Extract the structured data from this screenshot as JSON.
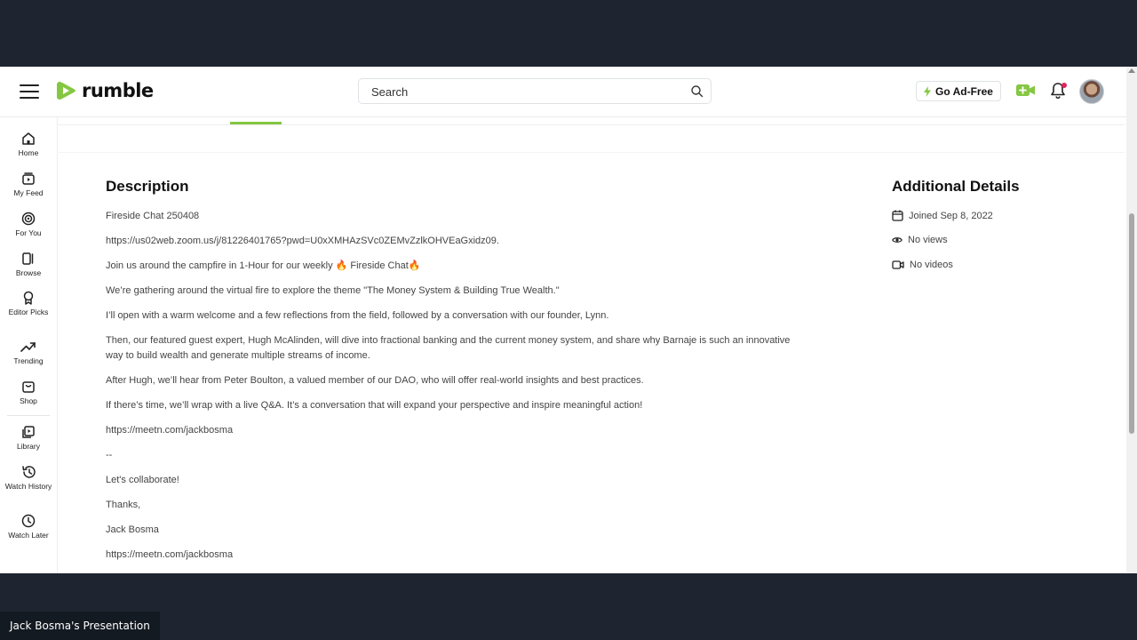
{
  "header": {
    "logo_text": "rumble",
    "search_placeholder": "Search",
    "ad_free_label": "Go Ad-Free",
    "brand_color": "#85c742"
  },
  "sidebar": {
    "items": [
      {
        "label": "Home",
        "icon": "home-icon"
      },
      {
        "label": "My Feed",
        "icon": "feed-icon"
      },
      {
        "label": "For You",
        "icon": "target-icon"
      },
      {
        "label": "Browse",
        "icon": "browse-icon"
      },
      {
        "label": "Editor Picks",
        "icon": "award-icon"
      },
      {
        "label": "Trending",
        "icon": "trending-icon"
      },
      {
        "label": "Shop",
        "icon": "shop-icon"
      },
      {
        "label": "Library",
        "icon": "library-icon"
      },
      {
        "label": "Watch History",
        "icon": "history-icon"
      },
      {
        "label": "Watch Later",
        "icon": "clock-icon"
      }
    ]
  },
  "description": {
    "title": "Description",
    "paragraphs": [
      "Fireside Chat 250408",
      "https://us02web.zoom.us/j/81226401765?pwd=U0xXMHAzSVc0ZEMvZzlkOHVEaGxidz09.",
      "Join us around the campfire in 1-Hour for our weekly 🔥 Fireside Chat🔥",
      "We’re gathering around the virtual fire to explore the theme \"The Money System & Building True Wealth.\"",
      "I’ll open with a warm welcome and a few reflections from the field, followed by a conversation with our founder, Lynn.",
      "Then, our featured guest expert, Hugh McAlinden, will dive into fractional banking and the current money system, and share why Barnaje is such an innovative way to build wealth and generate multiple streams of income.",
      "After Hugh, we’ll hear from Peter Boulton, a valued member of our DAO, who will offer real-world insights and best practices.",
      "If there’s time, we’ll wrap with a live Q&A. It’s a conversation that will expand your perspective and inspire meaningful action!",
      "https://meetn.com/jackbosma",
      "--",
      "Let's collaborate!",
      "Thanks,",
      "Jack Bosma",
      "https://meetn.com/jackbosma"
    ]
  },
  "details": {
    "title": "Additional Details",
    "joined": "Joined Sep 8, 2022",
    "views": "No views",
    "videos": "No videos"
  },
  "caption": "Jack Bosma's Presentation"
}
